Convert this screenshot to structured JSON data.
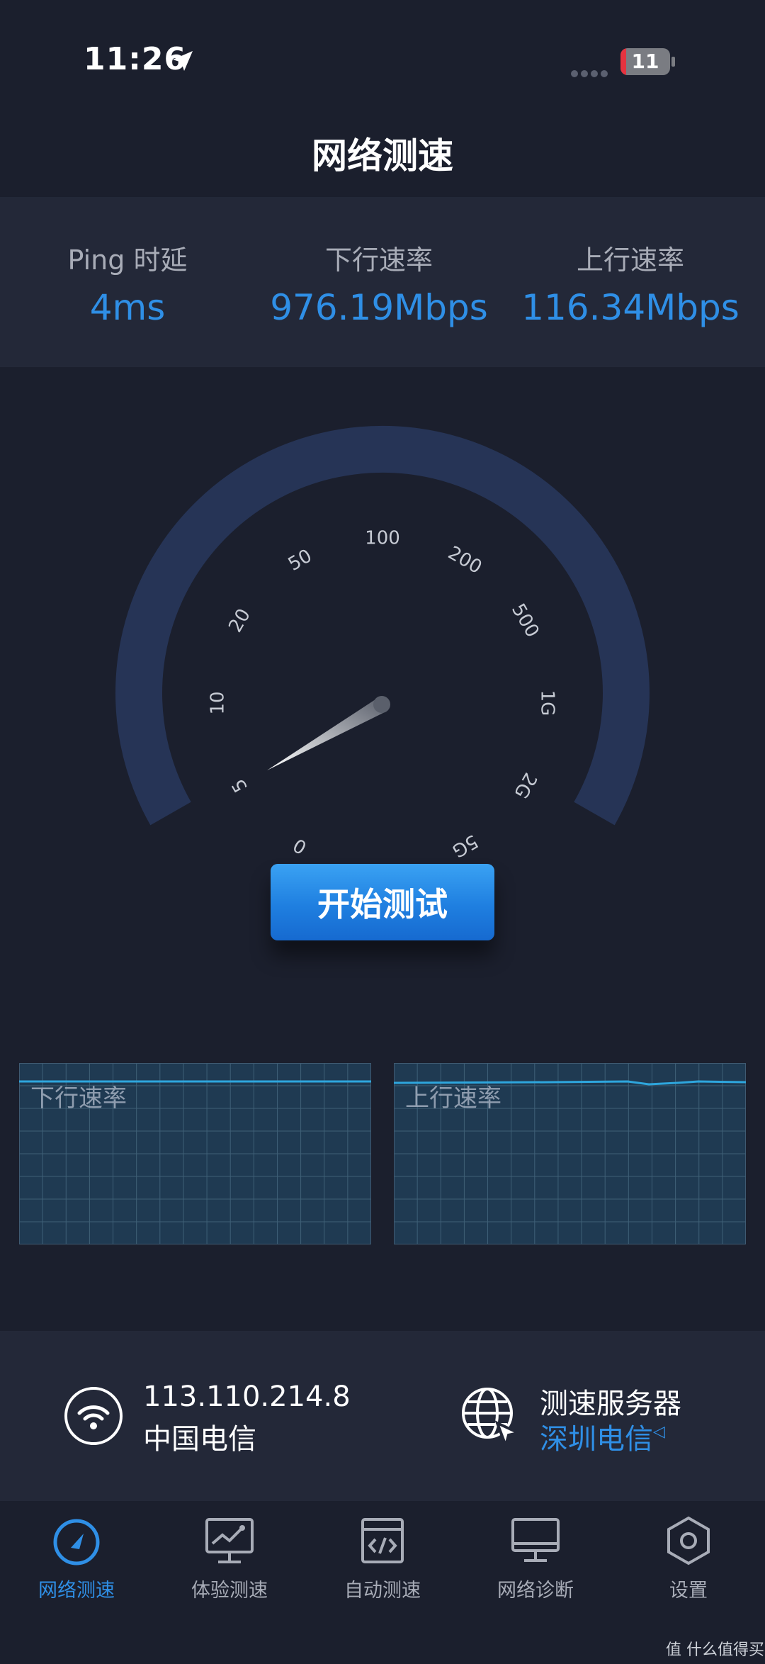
{
  "status_bar": {
    "time": "11:26",
    "battery_level": "11",
    "battery_fraction": 0.11,
    "location-icon": "location-arrow-icon"
  },
  "header": {
    "title": "网络测速"
  },
  "stats": {
    "ping": {
      "label": "Ping 时延",
      "value": "4ms"
    },
    "download": {
      "label": "下行速率",
      "value": "976.19Mbps"
    },
    "upload": {
      "label": "上行速率",
      "value": "116.34Mbps"
    }
  },
  "gauge": {
    "ticks": [
      "0",
      "5",
      "10",
      "20",
      "50",
      "100",
      "200",
      "500",
      "1G",
      "2G",
      "5G"
    ],
    "needle_value": "0",
    "colors": {
      "track": "#263456",
      "needle_start": "#ffffff",
      "needle_end": "#5a5f6b"
    }
  },
  "start_button": {
    "label": "开始测试"
  },
  "graphs": {
    "download": {
      "label": "下行速率"
    },
    "upload": {
      "label": "上行速率"
    }
  },
  "network": {
    "ip": "113.110.214.8",
    "isp": "中国电信",
    "server_title": "测速服务器",
    "server_name": "深圳电信",
    "server_arrow": "◁"
  },
  "tabs": [
    {
      "label": "网络测速",
      "icon": "speedometer-icon",
      "active": true
    },
    {
      "label": "体验测速",
      "icon": "monitor-chart-icon",
      "active": false
    },
    {
      "label": "自动测速",
      "icon": "code-window-icon",
      "active": false
    },
    {
      "label": "网络诊断",
      "icon": "desktop-icon",
      "active": false
    },
    {
      "label": "设置",
      "icon": "hexagon-gear-icon",
      "active": false
    }
  ],
  "watermark": "值 什么值得买",
  "colors": {
    "accent": "#2f8fe6",
    "background": "#1b1f2d",
    "band": "#232838",
    "graph_fill": "#1f3a52",
    "graph_line": "#2ea6dd"
  }
}
